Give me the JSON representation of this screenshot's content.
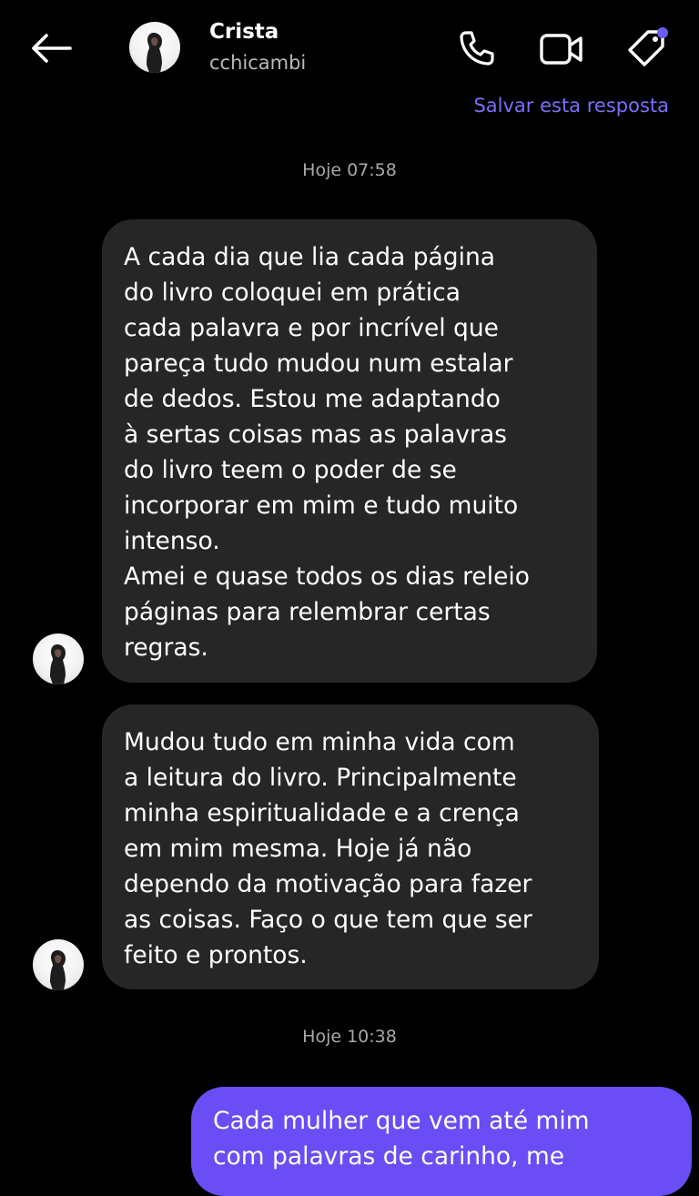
{
  "header": {
    "name": "Crista",
    "username": "cchicambi",
    "save_reply_label": "Salvar esta resposta",
    "icons": [
      "arrow-left-icon",
      "phone-icon",
      "video-camera-icon",
      "tag-icon"
    ],
    "accent_color": "#6b5cf6"
  },
  "conversation": {
    "timestamp_1": "Hoje 07:58",
    "message_1": "A cada dia que lia cada página\ndo livro coloquei em prática\ncada palavra e por incrível que\npareça tudo mudou num estalar\nde dedos. Estou me adaptando\nà sertas coisas mas as palavras\ndo livro teem o poder de se\nincorporar em mim e tudo muito\nintenso.\nAmei e quase todos os dias releio\npáginas para relembrar certas\nregras.",
    "message_2": "Mudou tudo em minha vida com\na leitura do livro. Principalmente\nminha espiritualidade e a crença\nem mim mesma. Hoje já não\ndependo da motivação para fazer\nas coisas. Faço o que tem que ser\nfeito e prontos.",
    "timestamp_2": "Hoje 10:38",
    "message_3": "Cada mulher que vem até mim\ncom palavras de carinho, me",
    "received_bubble_color": "#262626",
    "sent_bubble_color": "#6a4df4"
  }
}
